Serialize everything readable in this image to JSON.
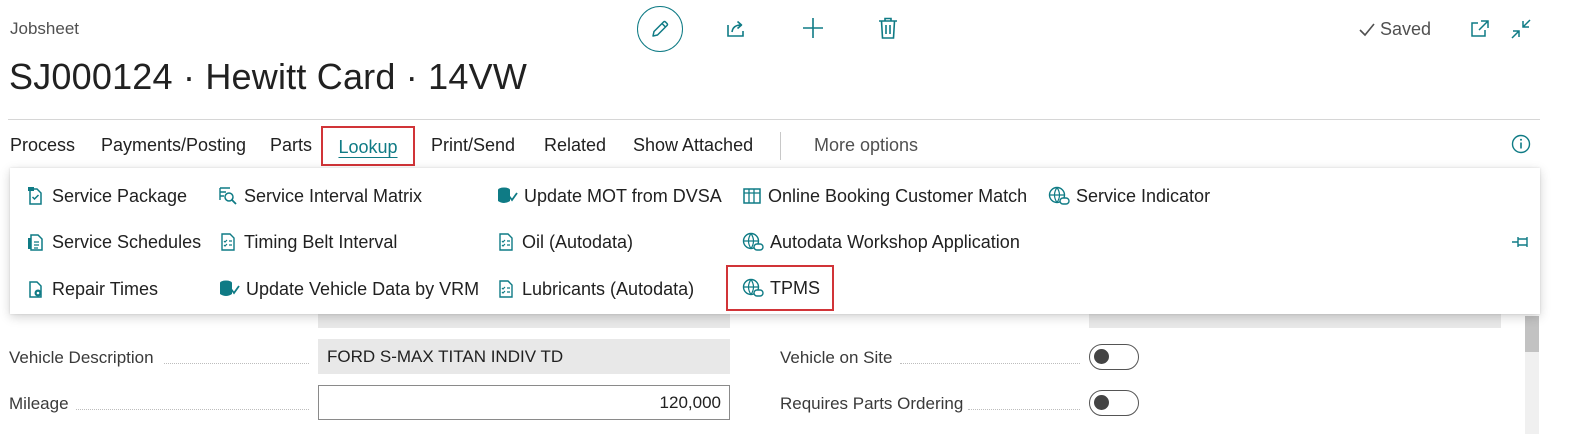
{
  "page": {
    "caption": "Jobsheet",
    "title": "SJ000124 · Hewitt Card · 14VW",
    "status": "Saved"
  },
  "toolbar": {
    "icons": [
      "edit-icon",
      "share-icon",
      "new-icon",
      "delete-icon",
      "open-new-window-icon",
      "collapse-icon"
    ]
  },
  "nav": {
    "items": [
      {
        "label": "Process"
      },
      {
        "label": "Payments/Posting"
      },
      {
        "label": "Parts"
      },
      {
        "label": "Lookup"
      },
      {
        "label": "Print/Send"
      },
      {
        "label": "Related"
      },
      {
        "label": "Show Attached"
      }
    ],
    "more": "More options",
    "active": "Lookup"
  },
  "menu": {
    "columns": [
      [
        {
          "label": "Service Package",
          "icon": "checklist-doc-icon"
        },
        {
          "label": "Service Schedules",
          "icon": "schedule-doc-icon"
        },
        {
          "label": "Repair Times",
          "icon": "settings-doc-icon"
        }
      ],
      [
        {
          "label": "Service Interval Matrix",
          "icon": "search-grid-icon"
        },
        {
          "label": "Timing Belt Interval",
          "icon": "checklist-page-icon"
        },
        {
          "label": "Update Vehicle Data by VRM",
          "icon": "database-update-icon"
        }
      ],
      [
        {
          "label": "Update MOT from DVSA",
          "icon": "database-update-icon"
        },
        {
          "label": "Oil (Autodata)",
          "icon": "checklist-page-icon"
        },
        {
          "label": "Lubricants (Autodata)",
          "icon": "checklist-page-icon"
        }
      ],
      [
        {
          "label": "Online Booking Customer Match",
          "icon": "table-icon"
        },
        {
          "label": "Autodata Workshop Application",
          "icon": "globe-link-icon"
        },
        {
          "label": "TPMS",
          "icon": "globe-link-icon"
        }
      ],
      [
        {
          "label": "Service Indicator",
          "icon": "globe-link-icon"
        }
      ]
    ]
  },
  "form": {
    "vehicle_description_label": "Vehicle Description",
    "vehicle_description_value": "FORD S-MAX TITAN INDIV TD",
    "mileage_label": "Mileage",
    "mileage_value": "120,000",
    "vehicle_on_site_label": "Vehicle on Site",
    "requires_parts_label": "Requires Parts Ordering"
  },
  "colors": {
    "accent": "#0f7b85",
    "highlight": "#d13438",
    "text": "#212121"
  }
}
